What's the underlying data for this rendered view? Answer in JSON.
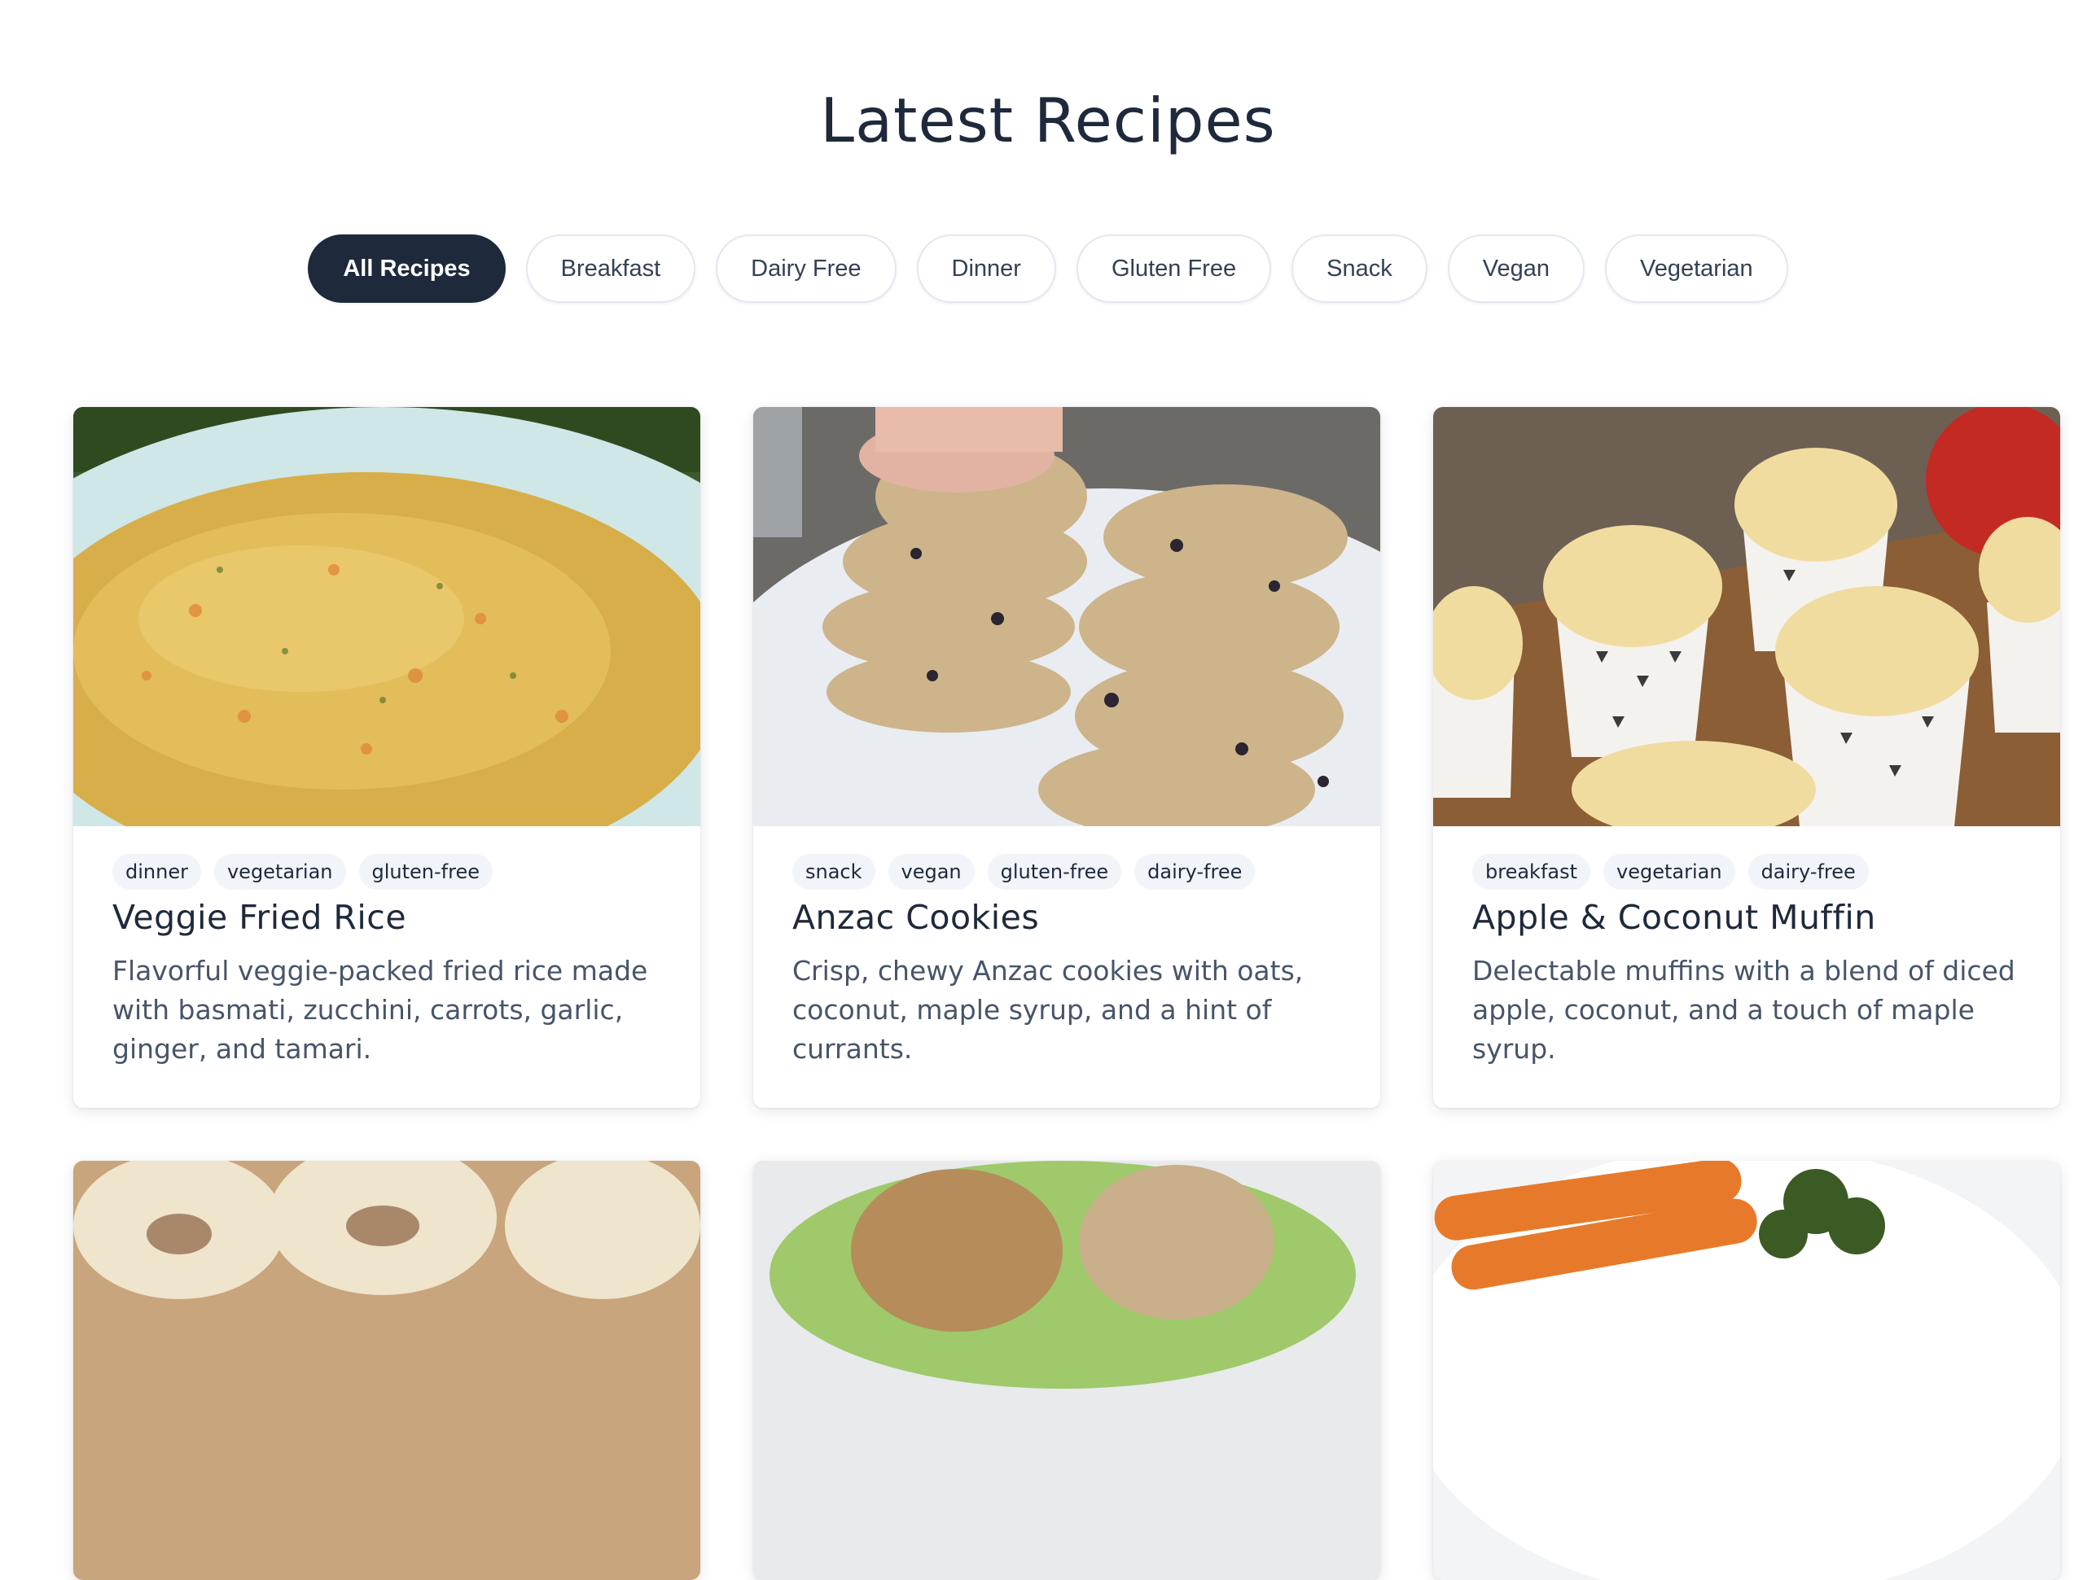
{
  "page": {
    "title": "Latest Recipes"
  },
  "filters": [
    {
      "label": "All Recipes",
      "active": true
    },
    {
      "label": "Breakfast",
      "active": false
    },
    {
      "label": "Dairy Free",
      "active": false
    },
    {
      "label": "Dinner",
      "active": false
    },
    {
      "label": "Gluten Free",
      "active": false
    },
    {
      "label": "Snack",
      "active": false
    },
    {
      "label": "Vegan",
      "active": false
    },
    {
      "label": "Vegetarian",
      "active": false
    }
  ],
  "recipes": [
    {
      "title": "Veggie Fried Rice",
      "tags": [
        "dinner",
        "vegetarian",
        "gluten-free"
      ],
      "description": "Flavorful veggie-packed fried rice made with basmati, zucchini, carrots, garlic, ginger, and tamari."
    },
    {
      "title": "Anzac Cookies",
      "tags": [
        "snack",
        "vegan",
        "gluten-free",
        "dairy-free"
      ],
      "description": "Crisp, chewy Anzac cookies with oats, coconut, maple syrup, and a hint of currants."
    },
    {
      "title": "Apple & Coconut Muffin",
      "tags": [
        "breakfast",
        "vegetarian",
        "dairy-free"
      ],
      "description": "Delectable muffins with a blend of diced apple, coconut, and a touch of maple syrup."
    }
  ],
  "colors": {
    "accent": "#1e293b",
    "tag_bg": "#f1f5f9",
    "text_muted": "#475569"
  }
}
